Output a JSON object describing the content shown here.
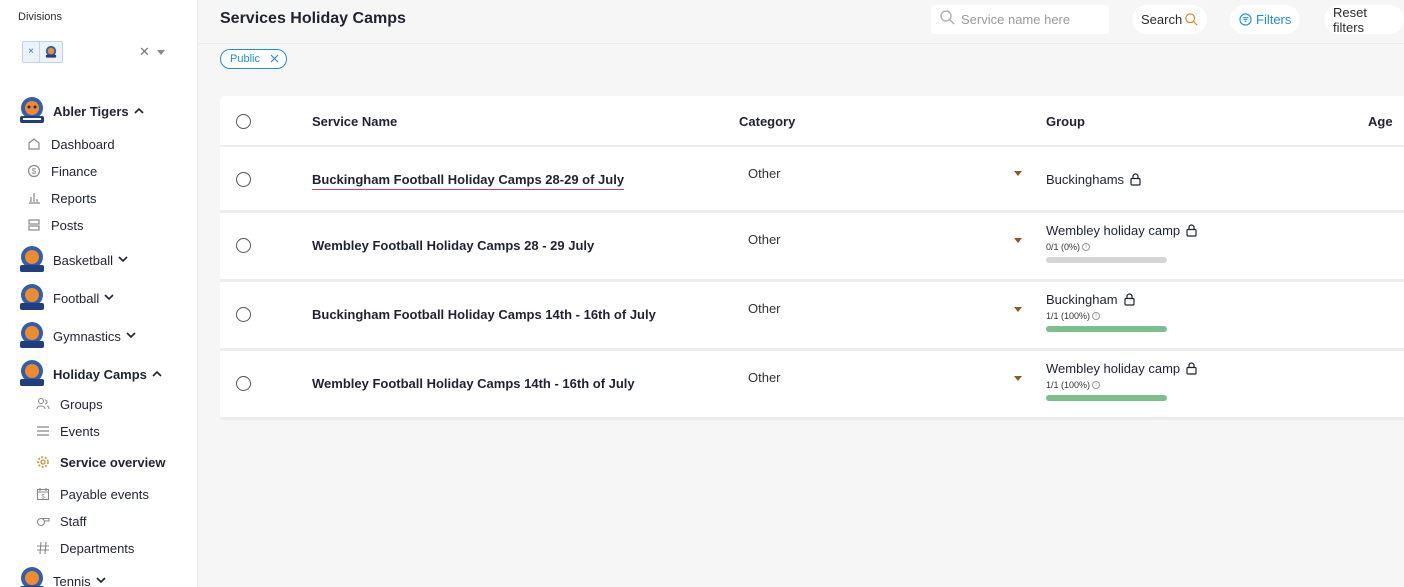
{
  "sidebar": {
    "divisions_label": "Divisions",
    "division_chip_x": "×",
    "clear_x": "✕",
    "clubs": [
      {
        "label": "Abler Tigers",
        "chevron": "^",
        "open": true
      },
      {
        "label": "Basketball",
        "chevron": "v"
      },
      {
        "label": "Football",
        "chevron": "v"
      },
      {
        "label": "Gymnastics",
        "chevron": "v"
      },
      {
        "label": "Holiday Camps",
        "chevron": "^",
        "open": true
      },
      {
        "label": "Tennis",
        "chevron": "v"
      }
    ],
    "abler_items": [
      {
        "label": "Dashboard",
        "icon": "home-icon"
      },
      {
        "label": "Finance",
        "icon": "dollar-icon"
      },
      {
        "label": "Reports",
        "icon": "bar-chart-icon"
      },
      {
        "label": "Posts",
        "icon": "posts-icon"
      }
    ],
    "holiday_items": [
      {
        "label": "Groups",
        "icon": "groups-icon"
      },
      {
        "label": "Events",
        "icon": "menu-icon"
      },
      {
        "label": "Service overview",
        "icon": "gear-icon",
        "active": true
      },
      {
        "label": "Payable events",
        "icon": "calendar-dollar-icon"
      },
      {
        "label": "Staff",
        "icon": "whistle-icon"
      },
      {
        "label": "Departments",
        "icon": "hash-icon"
      }
    ]
  },
  "header": {
    "title": "Services Holiday Camps",
    "search_placeholder": "Service name here",
    "search_button": "Search",
    "filters_button": "Filters",
    "reset_button": "Reset filters"
  },
  "filter_tag": {
    "label": "Public"
  },
  "table": {
    "columns": [
      "Service Name",
      "Category",
      "Group",
      "Age"
    ],
    "rows": [
      {
        "service": "Buckingham Football Holiday Camps 28-29 of July",
        "category": "Other",
        "group": "Buckinghams",
        "capacity": "",
        "fill": null
      },
      {
        "service": "Wembley Football Holiday Camps 28 - 29 July",
        "category": "Other",
        "group": "Wembley holiday camp",
        "capacity": "0/1 (0%)",
        "fill": 0
      },
      {
        "service": "Buckingham Football Holiday Camps 14th - 16th of July",
        "category": "Other",
        "group": "Buckingham",
        "capacity": "1/1 (100%)",
        "fill": 1
      },
      {
        "service": "Wembley Football Holiday Camps 14th - 16th of July",
        "category": "Other",
        "group": "Wembley holiday camp",
        "capacity": "1/1 (100%)",
        "fill": 1
      }
    ]
  },
  "colors": {
    "accent": "#1d8fe0",
    "active_icon": "#c8902f",
    "progress": "#7ac08c",
    "link_underline": "#d23c78"
  }
}
